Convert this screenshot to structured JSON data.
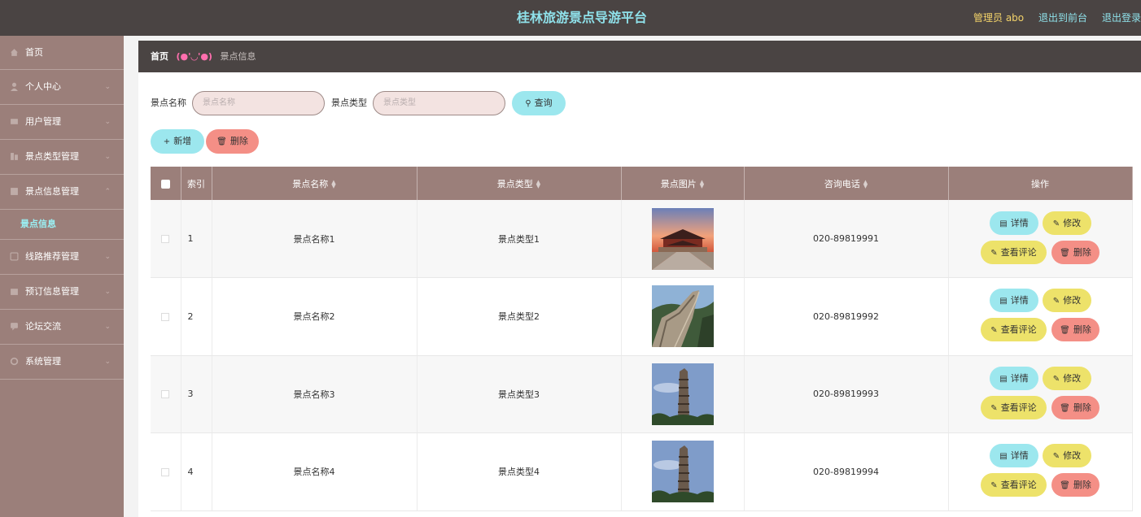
{
  "header": {
    "title": "桂林旅游景点导游平台",
    "admin": "管理员 abo",
    "back_front": "退出到前台",
    "logout": "退出登录"
  },
  "sidebar": {
    "items": [
      {
        "label": "首页",
        "icon": "home-icon"
      },
      {
        "label": "个人中心",
        "icon": "user-icon"
      },
      {
        "label": "用户管理",
        "icon": "users-icon"
      },
      {
        "label": "景点类型管理",
        "icon": "category-icon"
      },
      {
        "label": "景点信息管理",
        "icon": "info-icon"
      },
      {
        "label": "景点信息",
        "icon": ""
      },
      {
        "label": "线路推荐管理",
        "icon": "route-icon"
      },
      {
        "label": "预订信息管理",
        "icon": "booking-icon"
      },
      {
        "label": "论坛交流",
        "icon": "forum-icon"
      },
      {
        "label": "系统管理",
        "icon": "system-icon"
      }
    ]
  },
  "breadcrumb": {
    "home": "首页",
    "emoticon": "(●'◡'●)",
    "current": "景点信息"
  },
  "search": {
    "name_label": "景点名称",
    "name_placeholder": "景点名称",
    "type_label": "景点类型",
    "type_placeholder": "景点类型",
    "query_button": "查询"
  },
  "actions": {
    "add": "新增",
    "delete": "删除"
  },
  "table": {
    "headers": [
      "索引",
      "景点名称",
      "景点类型",
      "景点图片",
      "咨询电话",
      "操作"
    ],
    "row_buttons": {
      "detail": "详情",
      "edit": "修改",
      "comments": "查看评论",
      "delete": "删除"
    },
    "rows": [
      {
        "index": "1",
        "name": "景点名称1",
        "type": "景点类型1",
        "image": "temple-photo",
        "phone": "020-89819991"
      },
      {
        "index": "2",
        "name": "景点名称2",
        "type": "景点类型2",
        "image": "great-wall-photo",
        "phone": "020-89819992"
      },
      {
        "index": "3",
        "name": "景点名称3",
        "type": "景点类型3",
        "image": "pagoda-photo",
        "phone": "020-89819993"
      },
      {
        "index": "4",
        "name": "景点名称4",
        "type": "景点类型4",
        "image": "pagoda-photo",
        "phone": "020-89819994"
      }
    ]
  },
  "colors": {
    "header_bg": "#4a4443",
    "title": "#8fe1ea",
    "sidebar_bg": "#9b7f7a",
    "active_sub": "#9af0f4",
    "cyan_btn": "#9ce7ee",
    "red_btn": "#f48f86",
    "yellow_btn": "#ede26a"
  }
}
